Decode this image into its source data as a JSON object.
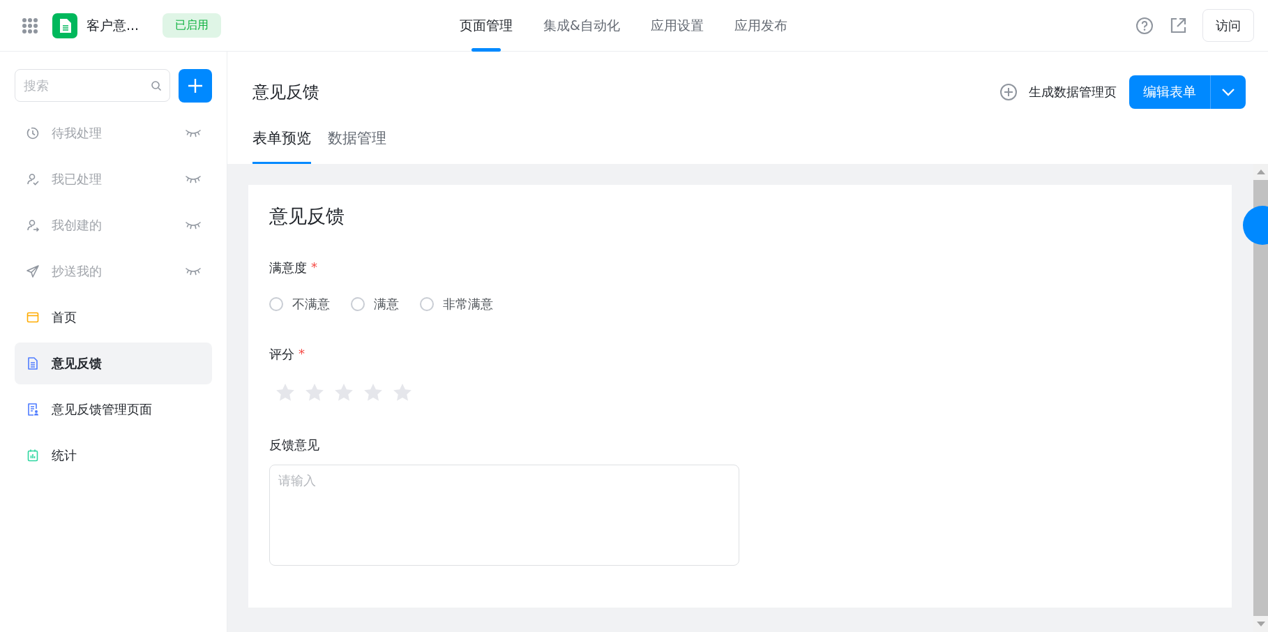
{
  "header": {
    "app_name": "客户意...",
    "status_badge": "已启用",
    "nav_tabs": [
      {
        "label": "页面管理",
        "selected": true
      },
      {
        "label": "集成&自动化",
        "selected": false
      },
      {
        "label": "应用设置",
        "selected": false
      },
      {
        "label": "应用发布",
        "selected": false
      }
    ],
    "visit_button": "访问"
  },
  "sidebar": {
    "search": {
      "placeholder": "搜索"
    },
    "items": [
      {
        "label": "待我处理",
        "kind": "clock",
        "hidden": true,
        "selected": false
      },
      {
        "label": "我已处理",
        "kind": "user-check",
        "hidden": true,
        "selected": false
      },
      {
        "label": "我创建的",
        "kind": "user-arrow",
        "hidden": true,
        "selected": false
      },
      {
        "label": "抄送我的",
        "kind": "send",
        "hidden": true,
        "selected": false
      },
      {
        "label": "首页",
        "kind": "home",
        "hidden": false,
        "selected": false
      },
      {
        "label": "意见反馈",
        "kind": "form",
        "hidden": false,
        "selected": true
      },
      {
        "label": "意见反馈管理页面",
        "kind": "manage",
        "hidden": false,
        "selected": false
      },
      {
        "label": "统计",
        "kind": "chart",
        "hidden": false,
        "selected": false
      }
    ]
  },
  "page": {
    "title": "意见反馈",
    "generate_button": "生成数据管理页",
    "edit_button": "编辑表单",
    "tabs": [
      {
        "label": "表单预览",
        "selected": true
      },
      {
        "label": "数据管理",
        "selected": false
      }
    ]
  },
  "form": {
    "title": "意见反馈",
    "fields": [
      {
        "kind": "radio",
        "label": "满意度",
        "required_mark": "*",
        "options": [
          {
            "label": "不满意",
            "selected": false
          },
          {
            "label": "满意",
            "selected": false
          },
          {
            "label": "非常满意",
            "selected": false
          }
        ]
      },
      {
        "kind": "rating",
        "label": "评分",
        "required_mark": "*",
        "stars": 0
      },
      {
        "kind": "textarea",
        "label": "反馈意见",
        "placeholder": "请输入"
      }
    ]
  }
}
